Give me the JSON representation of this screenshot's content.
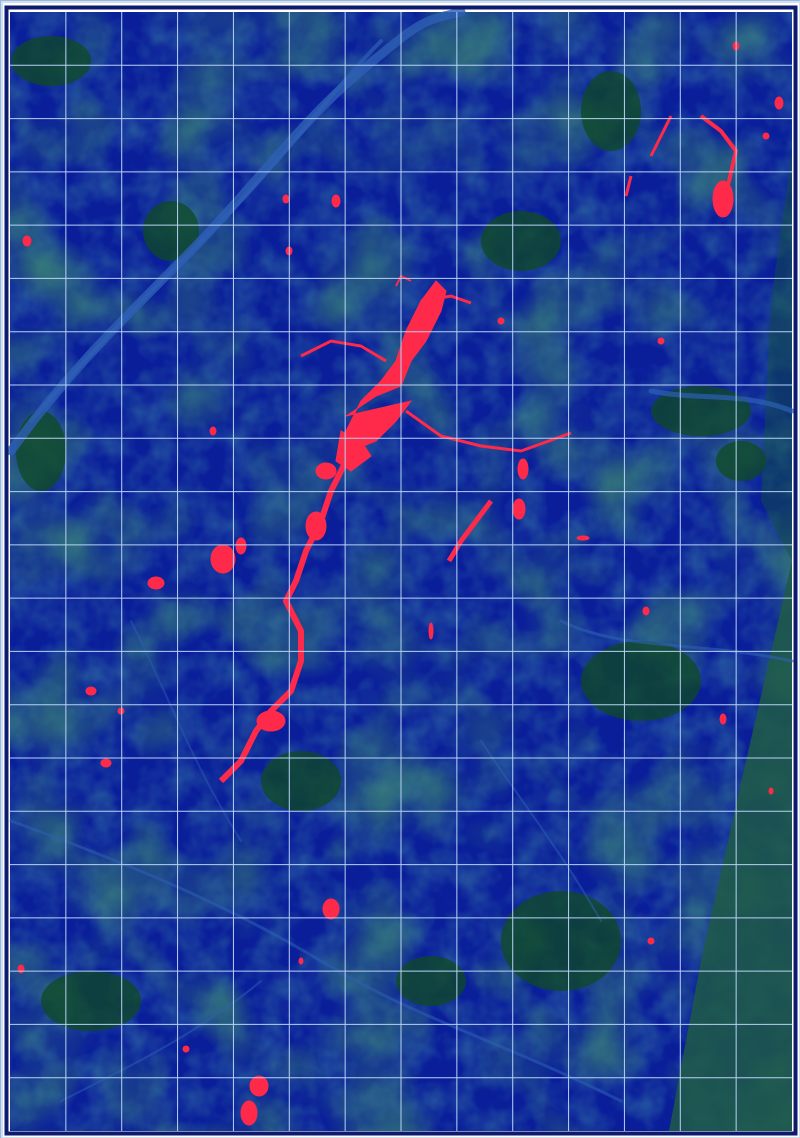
{
  "map": {
    "type": "false-color satellite composite with overlay grid",
    "grid": true,
    "grid_columns": 14,
    "grid_rows": 21,
    "text_labels": []
  },
  "colors": {
    "page_background": "#ffffff",
    "base_terrain": "#0a1e9a",
    "vegetation": "#0f4a22",
    "river": "#2e5fb5",
    "urban_highlight": "#ff2a4a",
    "grid_line": "#b8d2f5",
    "frame_border": "#0d1a6e"
  },
  "legend": {
    "urban_class": "urban / built-up (red)",
    "vegetation_class": "vegetation (green)",
    "terrain_class": "terrain (blue)"
  }
}
